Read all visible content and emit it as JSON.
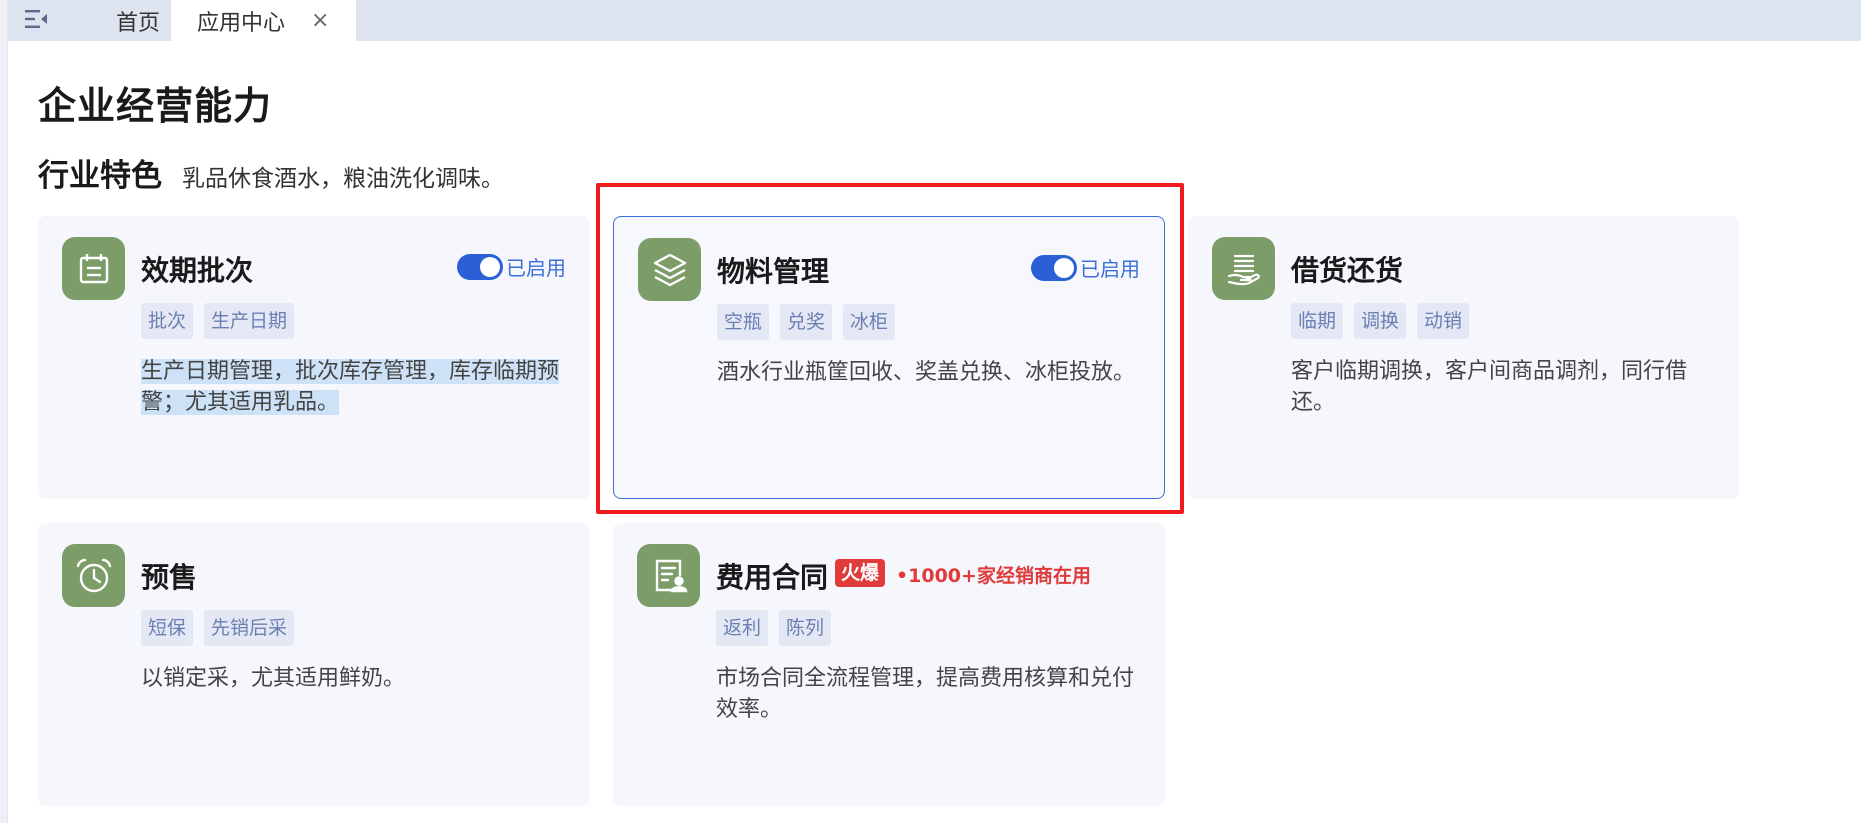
{
  "tabs": {
    "home": "首页",
    "active": "应用中心",
    "close": "×"
  },
  "page": {
    "title": "企业经营能力",
    "section_title": "行业特色",
    "section_desc": "乳品休食酒水，粮油洗化调味。"
  },
  "cards": [
    {
      "title": "效期批次",
      "icon": "calendar-icon",
      "tags": [
        "批次",
        "生产日期"
      ],
      "desc": "生产日期管理，批次库存管理，库存临期预警；尤其适用乳品。",
      "toggle_label": "已启用"
    },
    {
      "title": "物料管理",
      "icon": "layers-icon",
      "tags": [
        "空瓶",
        "兑奖",
        "冰柜"
      ],
      "desc": "酒水行业瓶筐回收、奖盖兑换、冰柜投放。",
      "toggle_label": "已启用"
    },
    {
      "title": "借货还货",
      "icon": "hand-document-icon",
      "tags": [
        "临期",
        "调换",
        "动销"
      ],
      "desc": "客户临期调换，客户间商品调剂，同行借还。"
    },
    {
      "title": "预售",
      "icon": "alarm-clock-icon",
      "tags": [
        "短保",
        "先销后采"
      ],
      "desc": "以销定采，尤其适用鲜奶。"
    },
    {
      "title": "费用合同",
      "icon": "contract-user-icon",
      "tags": [
        "返利",
        "陈列"
      ],
      "desc": "市场合同全流程管理，提高费用核算和兑付效率。",
      "hot_badge": "火爆",
      "hot_text": "•1000+家经销商在用"
    }
  ],
  "colors": {
    "accent": "#3d6fd8",
    "icon_bg": "#7c9c68",
    "hot": "#e03a3a",
    "annotation": "#ee1c1c"
  }
}
